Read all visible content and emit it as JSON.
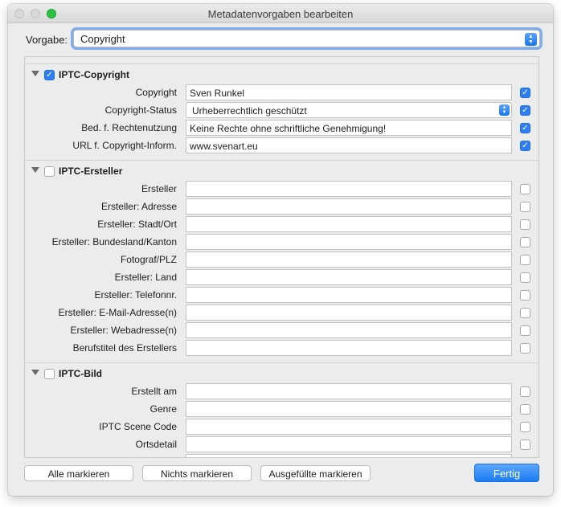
{
  "window": {
    "title": "Metadatenvorgaben bearbeiten"
  },
  "preset": {
    "label": "Vorgabe:",
    "value": "Copyright"
  },
  "sections": [
    {
      "title": "IPTC-Copyright",
      "checked": true,
      "fields": [
        {
          "label": "Copyright",
          "value": "Sven Runkel",
          "checked": true,
          "type": "text"
        },
        {
          "label": "Copyright-Status",
          "value": "Urheberrechtlich geschützt",
          "checked": true,
          "type": "select"
        },
        {
          "label": "Bed. f. Rechtenutzung",
          "value": "Keine Rechte ohne schriftliche Genehmigung!",
          "checked": true,
          "type": "text"
        },
        {
          "label": "URL f. Copyright-Inform.",
          "value": "www.svenart.eu",
          "checked": true,
          "type": "text"
        }
      ]
    },
    {
      "title": "IPTC-Ersteller",
      "checked": false,
      "fields": [
        {
          "label": "Ersteller",
          "value": "",
          "checked": false,
          "type": "text"
        },
        {
          "label": "Ersteller: Adresse",
          "value": "",
          "checked": false,
          "type": "text"
        },
        {
          "label": "Ersteller: Stadt/Ort",
          "value": "",
          "checked": false,
          "type": "text"
        },
        {
          "label": "Ersteller: Bundesland/Kanton",
          "value": "",
          "checked": false,
          "type": "text"
        },
        {
          "label": "Fotograf/PLZ",
          "value": "",
          "checked": false,
          "type": "text"
        },
        {
          "label": "Ersteller: Land",
          "value": "",
          "checked": false,
          "type": "text"
        },
        {
          "label": "Ersteller: Telefonnr.",
          "value": "",
          "checked": false,
          "type": "text"
        },
        {
          "label": "Ersteller: E-Mail-Adresse(n)",
          "value": "",
          "checked": false,
          "type": "text"
        },
        {
          "label": "Ersteller: Webadresse(n)",
          "value": "",
          "checked": false,
          "type": "text"
        },
        {
          "label": "Berufstitel des Erstellers",
          "value": "",
          "checked": false,
          "type": "text"
        }
      ]
    },
    {
      "title": "IPTC-Bild",
      "checked": false,
      "fields": [
        {
          "label": "Erstellt am",
          "value": "",
          "checked": false,
          "type": "text"
        },
        {
          "label": "Genre",
          "value": "",
          "checked": false,
          "type": "text"
        },
        {
          "label": "IPTC Scene Code",
          "value": "",
          "checked": false,
          "type": "text"
        },
        {
          "label": "Ortsdetail",
          "value": "",
          "checked": false,
          "type": "text"
        },
        {
          "label": "",
          "value": "",
          "checked": false,
          "type": "text"
        }
      ]
    }
  ],
  "buttons": {
    "mark_all": "Alle markieren",
    "mark_none": "Nichts markieren",
    "mark_filled": "Ausgefüllte markieren",
    "done": "Fertig"
  },
  "colors": {
    "accent": "#2f7ff2",
    "focus_ring": "#7eaef0"
  }
}
